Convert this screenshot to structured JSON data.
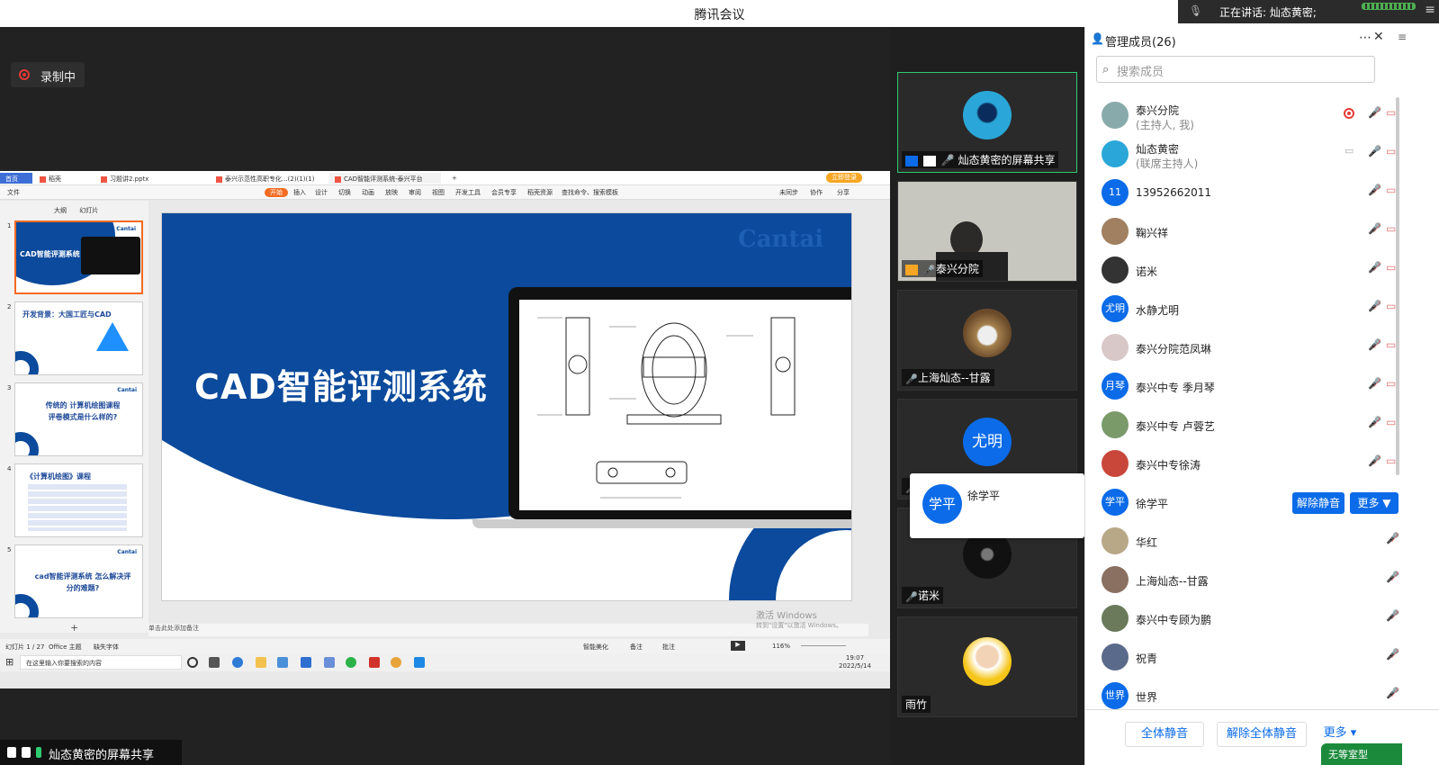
{
  "app_title": "腾讯会议",
  "speaking": {
    "label": "正在讲话: 灿态黄密;"
  },
  "recording": {
    "label": "录制中"
  },
  "wps": {
    "tabs": [
      {
        "label": "首页"
      },
      {
        "label": "稻壳"
      },
      {
        "label": "习题讲2.pptx"
      },
      {
        "label": "泰兴示范性高职专化...(2)(1)(1)"
      },
      {
        "label": "CAD智能评测系统-泰兴平台"
      }
    ],
    "login_label": "立即登录",
    "ribbon": [
      "文件",
      "开始",
      "插入",
      "设计",
      "切换",
      "动画",
      "放映",
      "审阅",
      "视图",
      "开发工具",
      "会员专享",
      "稻壳资源",
      "查找命令、搜索模板",
      "未同步",
      "协作",
      "分享"
    ],
    "panel_tabs": [
      "大纲",
      "幻灯片"
    ],
    "thumbs": [
      {
        "num": "1",
        "title": "CAD智能评测系统"
      },
      {
        "num": "2",
        "title": "开发背景：大国工匠与CAD"
      },
      {
        "num": "3",
        "title": "传统的 计算机绘图课程 评卷模式是什么样的?"
      },
      {
        "num": "4",
        "title": "《计算机绘图》课程"
      },
      {
        "num": "5",
        "title": "cad智能评测系统 怎么解决评分的难题?"
      }
    ],
    "slide_title": "CAD智能评测系统",
    "slide_brand": "Cantai",
    "note_placeholder": "单击此处添加备注",
    "status_left": "幻灯片 1 / 27",
    "status_theme": "Office 主题",
    "status_font": "缺失字体",
    "status_beautify": "智能美化",
    "status_note": "备注",
    "status_comment": "批注",
    "zoom": "116%",
    "activation_title": "激活 Windows",
    "activation_sub": "转到\"设置\"以激活 Windows。",
    "taskbar_search": "在这里输入你要搜索的内容",
    "taskbar_time": "19:07",
    "taskbar_date": "2022/5/14"
  },
  "bottom_share_label": "灿态黄密的屏幕共享",
  "videos": [
    {
      "name": "灿态黄密的屏幕共享",
      "muted": false
    },
    {
      "name": "泰兴分院",
      "muted": true
    },
    {
      "name": "上海灿态--甘露",
      "muted": true
    },
    {
      "name": "尤明",
      "muted": true,
      "avatar_text": "尤明"
    },
    {
      "name": "诺米",
      "muted": true
    },
    {
      "name": "雨竹",
      "muted": false
    }
  ],
  "popup": {
    "avatar_text": "学平",
    "name": "徐学平"
  },
  "members": {
    "title": "管理成员(26)",
    "search_placeholder": "搜索成员",
    "list": [
      {
        "name": "泰兴分院",
        "sub": "(主持人, 我)",
        "avatar": "photo",
        "color": "#8aa"
      },
      {
        "name": "灿态黄密",
        "sub": "(联席主持人)",
        "avatar": "photo",
        "color": "#2aa7d8"
      },
      {
        "name": "13952662011",
        "sub": "",
        "avatar": "11",
        "color": "#0b6be8"
      },
      {
        "name": "鞠兴祥",
        "sub": "",
        "avatar": "photo",
        "color": "#a08060"
      },
      {
        "name": "诺米",
        "sub": "",
        "avatar": "photo",
        "color": "#333"
      },
      {
        "name": "水静尤明",
        "sub": "",
        "avatar": "尤明",
        "color": "#0b6be8"
      },
      {
        "name": "泰兴分院范凤琳",
        "sub": "",
        "avatar": "photo",
        "color": "#d9c8c8"
      },
      {
        "name": "泰兴中专 季月琴",
        "sub": "",
        "avatar": "月琴",
        "color": "#0b6be8"
      },
      {
        "name": "泰兴中专 卢蓉艺",
        "sub": "",
        "avatar": "photo",
        "color": "#7a9a6a"
      },
      {
        "name": "泰兴中专徐涛",
        "sub": "",
        "avatar": "photo",
        "color": "#c8473a"
      },
      {
        "name": "徐学平",
        "sub": "",
        "avatar": "学平",
        "color": "#0b6be8"
      },
      {
        "name": "华红",
        "sub": "",
        "avatar": "photo",
        "color": "#b8a888"
      },
      {
        "name": "上海灿态--甘露",
        "sub": "",
        "avatar": "photo",
        "color": "#8a7060"
      },
      {
        "name": "泰兴中专顾为鹏",
        "sub": "",
        "avatar": "photo",
        "color": "#6a7a5a"
      },
      {
        "name": "祝青",
        "sub": "",
        "avatar": "photo",
        "color": "#5a6a8a"
      },
      {
        "name": "世界",
        "sub": "",
        "avatar": "世界",
        "color": "#0b6be8"
      }
    ],
    "unmute_label": "解除静音",
    "more_label": "更多 ▼",
    "footer": {
      "mute_all": "全体静音",
      "unmute_all": "解除全体静音",
      "more": "更多 ▾"
    },
    "overflow_label": "无等室型"
  }
}
